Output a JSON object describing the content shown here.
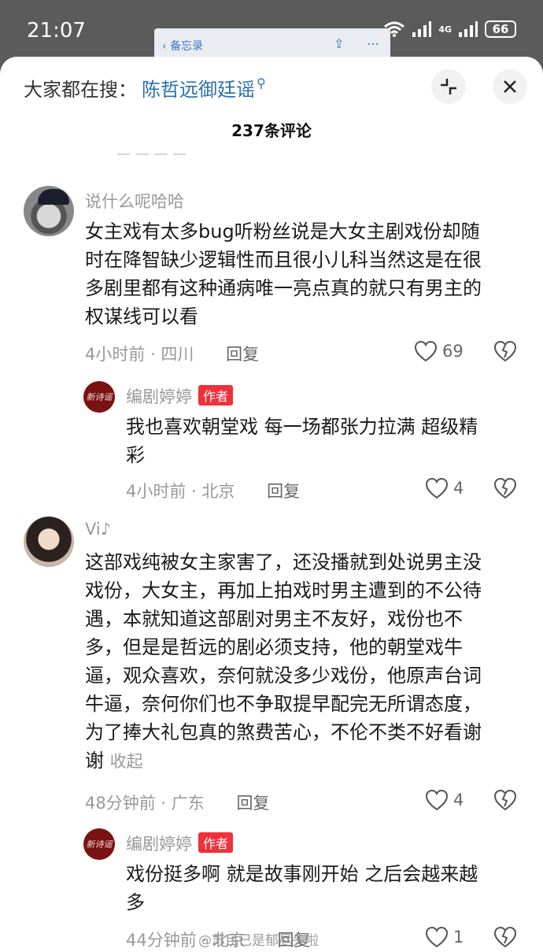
{
  "status_bar": {
    "time": "21:07",
    "network": "4G",
    "battery": "66"
  },
  "memo_bar": {
    "back_label": "备忘录"
  },
  "header": {
    "search_prefix": "大家都在搜：",
    "search_term": "陈哲远御廷谣",
    "count_title": "237条评论"
  },
  "comments": [
    {
      "username": "说什么呢哈哈",
      "text_lines": [
        "女主戏有太多bug听粉丝说是大女主剧戏份却随",
        "时在降智缺少逻辑性而且很小儿科当然这是在很",
        "多剧里都有这种通病唯一亮点真的就只有男主的",
        "权谋线可以看"
      ],
      "time": "4小时前 · 四川",
      "reply_label": "回复",
      "likes": "69",
      "reply": {
        "username": "编剧婷婷",
        "badge": "作者",
        "text_lines": [
          "我也喜欢朝堂戏 每一场都张力拉满 超级精",
          "彩"
        ],
        "time": "4小时前 · 北京",
        "reply_label": "回复",
        "likes": "4"
      }
    },
    {
      "username": "Vi♪",
      "text_lines": [
        "这部戏纯被女主家害了，还没播就到处说男主没",
        "戏份，大女主，再加上拍戏时男主遭到的不公待",
        "遇，本就知道这部剧对男主不友好，戏份也不",
        "多，但是是哲远的剧必须支持，他的朝堂戏牛",
        "逼，观众喜欢，奈何就没多少戏份，他原声台词",
        "牛逼，奈何你们也不争取提早配完无所谓态度，",
        "为了捧大礼包真的煞费苦心，不伦不类不好看谢"
      ],
      "last_line": "谢",
      "fold_label": "收起",
      "time": "48分钟前 · 广东",
      "reply_label": "回复",
      "likes": "4",
      "reply": {
        "username": "编剧婷婷",
        "badge": "作者",
        "text_lines": [
          "戏份挺多啊 就是故事刚开始 之后会越来越",
          "多"
        ],
        "time": "44分钟前 · 北京",
        "reply_label": "回复",
        "likes": "1"
      }
    }
  ],
  "avatar_writer_text": "新诗谣",
  "watermark": "@苏目已是郁尽头啦"
}
